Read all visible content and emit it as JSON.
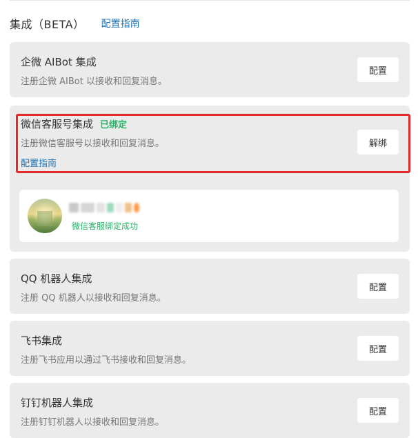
{
  "header": {
    "title": "集成（BETA）",
    "guide_link": "配置指南"
  },
  "cards": [
    {
      "title": "企微 AIBot 集成",
      "desc": "注册企微 AIBot 以接收和回复消息。",
      "button": "配置"
    },
    {
      "title": "微信客服号集成",
      "status": "已绑定",
      "desc": "注册微信客服号以接收和回复消息。",
      "guide_link": "配置指南",
      "button": "解绑",
      "bound_account": {
        "status_text": "微信客服绑定成功"
      }
    },
    {
      "title": "QQ 机器人集成",
      "desc": "注册 QQ 机器人以接收和回复消息。",
      "button": "配置"
    },
    {
      "title": "飞书集成",
      "desc": "注册飞书应用以通过飞书接收和回复消息。",
      "button": "配置"
    },
    {
      "title": "钉钉机器人集成",
      "desc": "注册钉钉机器人以接收和回复消息。",
      "button": "配置"
    }
  ],
  "colors": {
    "link": "#1a73b8",
    "success": "#2bb36a",
    "highlight_border": "#e02b2b",
    "card_bg": "#ebebeb"
  }
}
